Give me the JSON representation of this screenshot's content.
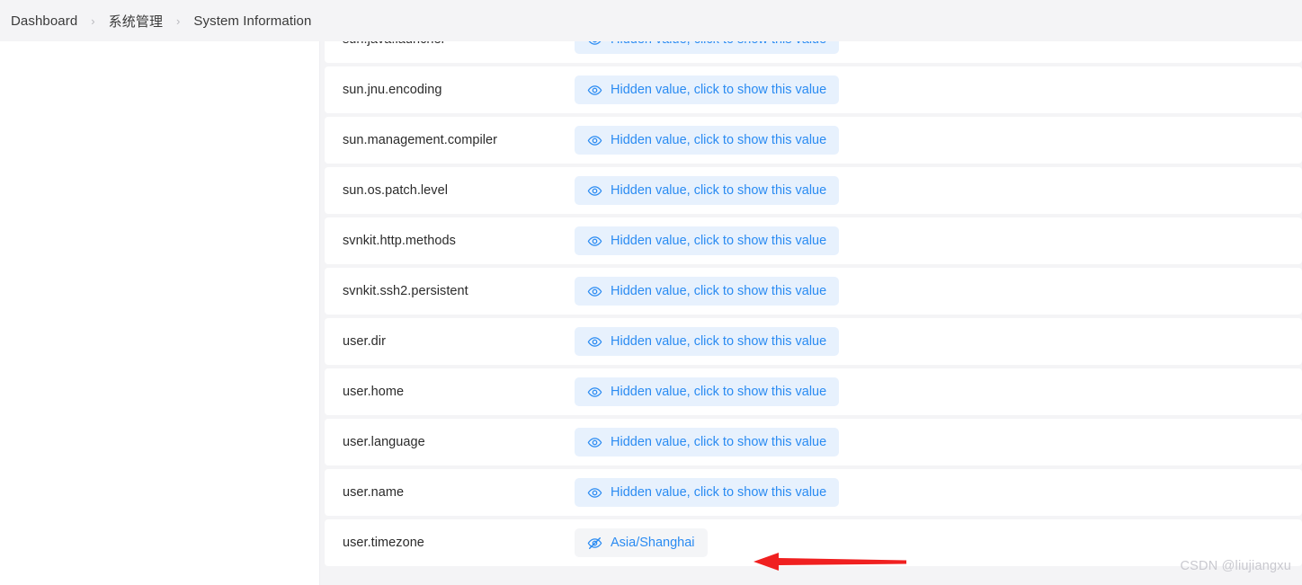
{
  "breadcrumb": {
    "separator": "›",
    "items": [
      {
        "label": "Dashboard"
      },
      {
        "label": "系统管理"
      },
      {
        "label": "System Information"
      }
    ]
  },
  "table": {
    "hidden_value_label": "Hidden value, click to show this value",
    "rows": [
      {
        "key": "sun.java.launcher",
        "state": "hidden",
        "value": "Hidden value, click to show this value"
      },
      {
        "key": "sun.jnu.encoding",
        "state": "hidden",
        "value": "Hidden value, click to show this value"
      },
      {
        "key": "sun.management.compiler",
        "state": "hidden",
        "value": "Hidden value, click to show this value"
      },
      {
        "key": "sun.os.patch.level",
        "state": "hidden",
        "value": "Hidden value, click to show this value"
      },
      {
        "key": "svnkit.http.methods",
        "state": "hidden",
        "value": "Hidden value, click to show this value"
      },
      {
        "key": "svnkit.ssh2.persistent",
        "state": "hidden",
        "value": "Hidden value, click to show this value"
      },
      {
        "key": "user.dir",
        "state": "hidden",
        "value": "Hidden value, click to show this value"
      },
      {
        "key": "user.home",
        "state": "hidden",
        "value": "Hidden value, click to show this value"
      },
      {
        "key": "user.language",
        "state": "hidden",
        "value": "Hidden value, click to show this value"
      },
      {
        "key": "user.name",
        "state": "hidden",
        "value": "Hidden value, click to show this value"
      },
      {
        "key": "user.timezone",
        "state": "shown",
        "value": "Asia/Shanghai"
      }
    ]
  },
  "annotation": {
    "arrow_color": "#f02020",
    "arrow_direction": "left"
  },
  "watermark": {
    "text": "CSDN @liujiangxu"
  },
  "colors": {
    "badge_hidden_bg": "#e7f1fd",
    "badge_shown_bg": "#f4f5f7",
    "badge_text": "#2a8bf2",
    "page_bg": "#f4f4f6",
    "row_bg": "#ffffff",
    "breadcrumb_bg": "#f4f4f6"
  }
}
